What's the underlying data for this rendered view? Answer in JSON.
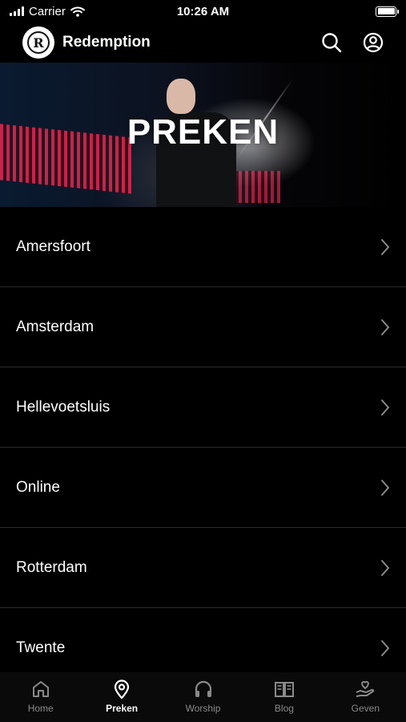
{
  "status_bar": {
    "carrier": "Carrier",
    "time": "10:26 AM"
  },
  "header": {
    "title": "Redemption",
    "logo_letter": "R"
  },
  "hero": {
    "title": "PREKEN"
  },
  "locations": [
    {
      "label": "Amersfoort"
    },
    {
      "label": "Amsterdam"
    },
    {
      "label": "Hellevoetsluis"
    },
    {
      "label": "Online"
    },
    {
      "label": "Rotterdam"
    },
    {
      "label": "Twente"
    }
  ],
  "tabs": [
    {
      "label": "Home",
      "icon": "home-icon",
      "active": false
    },
    {
      "label": "Preken",
      "icon": "location-pin-icon",
      "active": true
    },
    {
      "label": "Worship",
      "icon": "headphones-icon",
      "active": false
    },
    {
      "label": "Blog",
      "icon": "book-icon",
      "active": false
    },
    {
      "label": "Geven",
      "icon": "heart-hand-icon",
      "active": false
    }
  ],
  "colors": {
    "background": "#000000",
    "tab_inactive": "#8a8a8a",
    "tab_active": "#ffffff",
    "divider": "#2a2a2a"
  }
}
